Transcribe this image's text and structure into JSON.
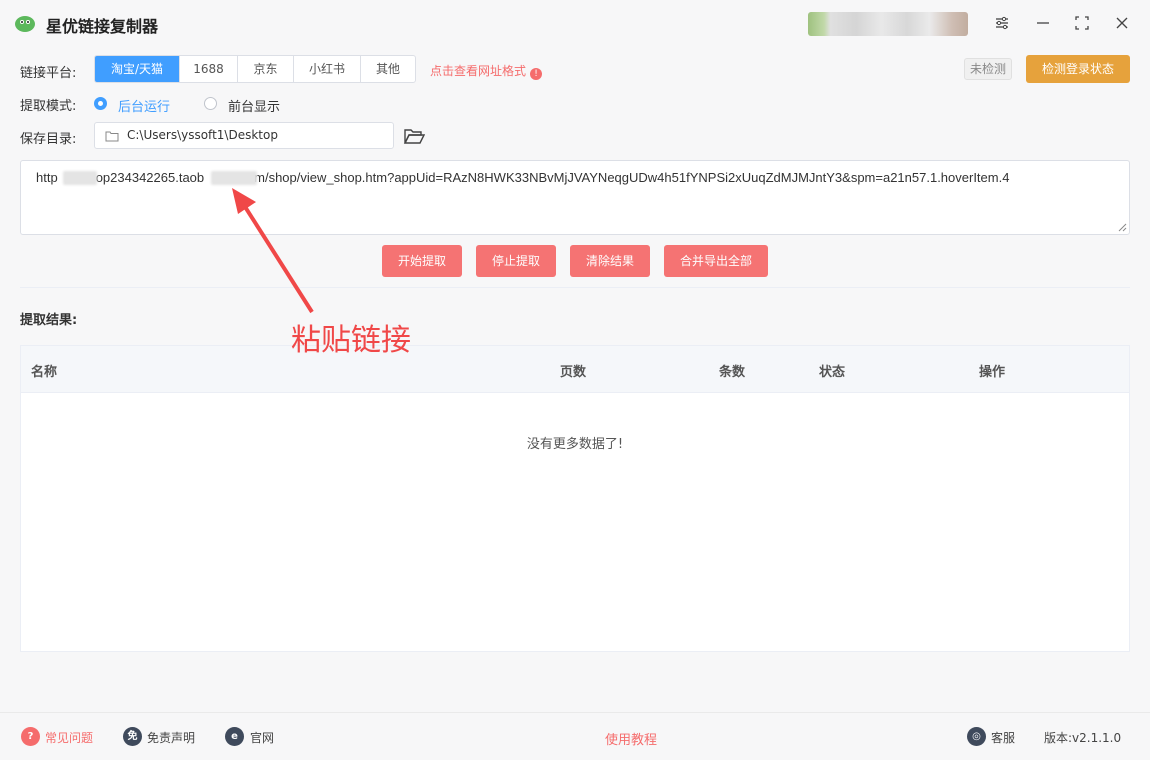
{
  "app": {
    "title": "星优链接复制器"
  },
  "window_controls": [
    "settings-icon",
    "minimize-icon",
    "maximize-icon",
    "close-icon"
  ],
  "platform": {
    "label": "链接平台:",
    "tabs": [
      "淘宝/天猫",
      "1688",
      "京东",
      "小红书",
      "其他"
    ],
    "active_index": 0,
    "url_format_link": "点击查看网址格式"
  },
  "login": {
    "status_badge": "未检测",
    "check_button": "检测登录状态"
  },
  "mode": {
    "label": "提取模式:",
    "options": [
      "后台运行",
      "前台显示"
    ],
    "selected_index": 0
  },
  "save_dir": {
    "label": "保存目录:",
    "path": "C:\\Users\\yssoft1\\Desktop"
  },
  "link_input": {
    "parts": [
      "http",
      "op234342265.taob",
      "m/shop/view_shop.htm?appUid=RAzN8HWK33NBvMjJVAYNeqgUDw4h51fYNPSi2xUuqZdMJMJntY3&spm=a21n57.1.hoverItem.4"
    ]
  },
  "actions": [
    "开始提取",
    "停止提取",
    "清除结果",
    "合并导出全部"
  ],
  "annotation": {
    "text": "粘贴链接"
  },
  "results": {
    "title": "提取结果:",
    "columns": [
      "名称",
      "页数",
      "条数",
      "状态",
      "操作"
    ],
    "empty_text": "没有更多数据了!"
  },
  "footer": {
    "faq": "常见问题",
    "disclaimer": "免责声明",
    "website": "官网",
    "tutorial": "使用教程",
    "support": "客服",
    "version": "版本:v2.1.1.0"
  },
  "colors": {
    "primary": "#409eff",
    "danger": "#f56c6c",
    "warning": "#e6a23c"
  }
}
